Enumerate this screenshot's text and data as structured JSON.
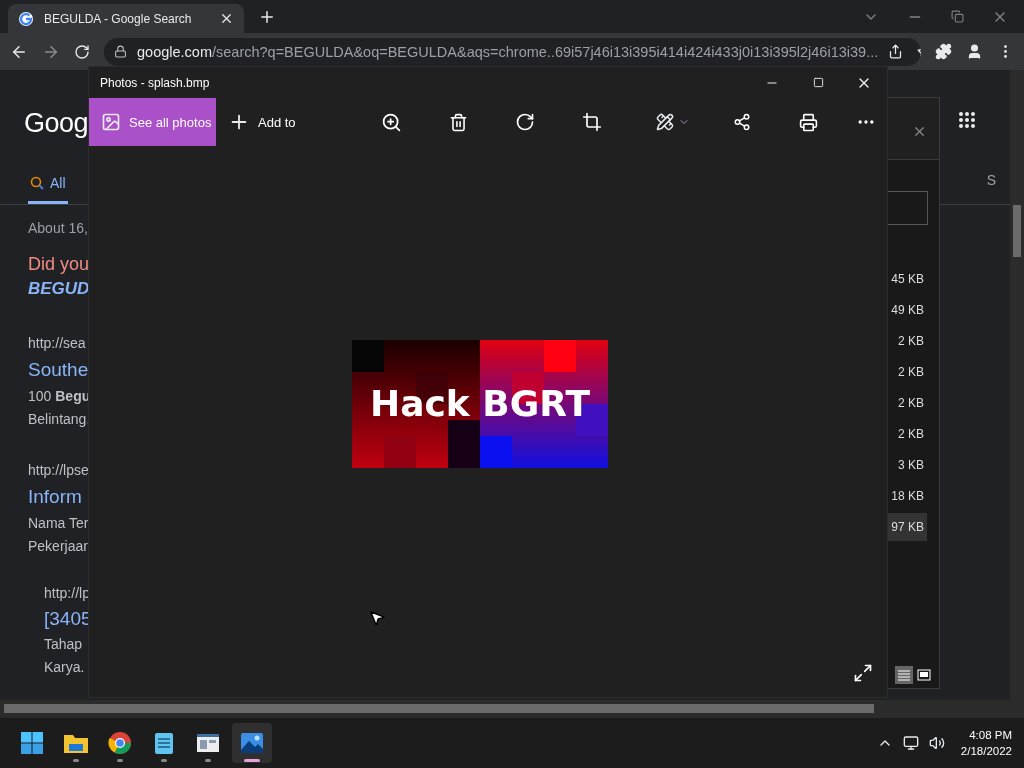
{
  "browser": {
    "tabs": [
      {
        "title": "BEGULDA - Google Search",
        "selected": true
      }
    ],
    "url_host": "google.com",
    "url_path": "/search?q=BEGULDA&oq=BEGULDA&aqs=chrome..69i57j46i13i395i414i424i433j0i13i395l2j46i13i39..."
  },
  "google": {
    "logo": "Goog",
    "tabs": [
      {
        "label": "All",
        "selected": true
      },
      {
        "label": "S",
        "selected": false
      }
    ],
    "result_stats": "About 16,",
    "did_you_mean": "Did you",
    "suggestion": "BEGUD",
    "results": [
      {
        "kind": "main",
        "url": "http://sea",
        "title": "Southe",
        "snippet": [
          "100 **Begu**",
          "Belintang,"
        ]
      },
      {
        "kind": "main",
        "url": "http://lpse",
        "title": "Inform",
        "snippet": [
          "Nama Ter",
          "Pekerjaan"
        ]
      },
      {
        "kind": "sub",
        "url": "http://lp",
        "title": "[3405",
        "snippet": [
          "Tahap",
          "Karya."
        ]
      }
    ]
  },
  "explorer": {
    "rows": [
      {
        "size": "45 KB",
        "selected": false
      },
      {
        "size": "49 KB",
        "selected": false
      },
      {
        "size": "2 KB",
        "selected": false
      },
      {
        "size": "2 KB",
        "selected": false
      },
      {
        "size": "2 KB",
        "selected": false
      },
      {
        "size": "2 KB",
        "selected": false
      },
      {
        "size": "3 KB",
        "selected": false
      },
      {
        "size": "18 KB",
        "selected": false
      },
      {
        "size": "97 KB",
        "selected": true
      }
    ]
  },
  "photos": {
    "title": "Photos - splash.bmp",
    "see_all": "See all photos",
    "add_to": "Add to",
    "image_text": "Hack BGRT"
  },
  "taskbar": {
    "apps": [
      {
        "kind": "start",
        "selected": false
      },
      {
        "kind": "folder",
        "selected": false
      },
      {
        "kind": "chrome",
        "selected": false
      },
      {
        "kind": "notepad",
        "selected": false
      },
      {
        "kind": "window",
        "selected": false
      },
      {
        "kind": "photos",
        "selected": true
      }
    ],
    "time": "4:08 PM",
    "date": "2/18/2022"
  }
}
